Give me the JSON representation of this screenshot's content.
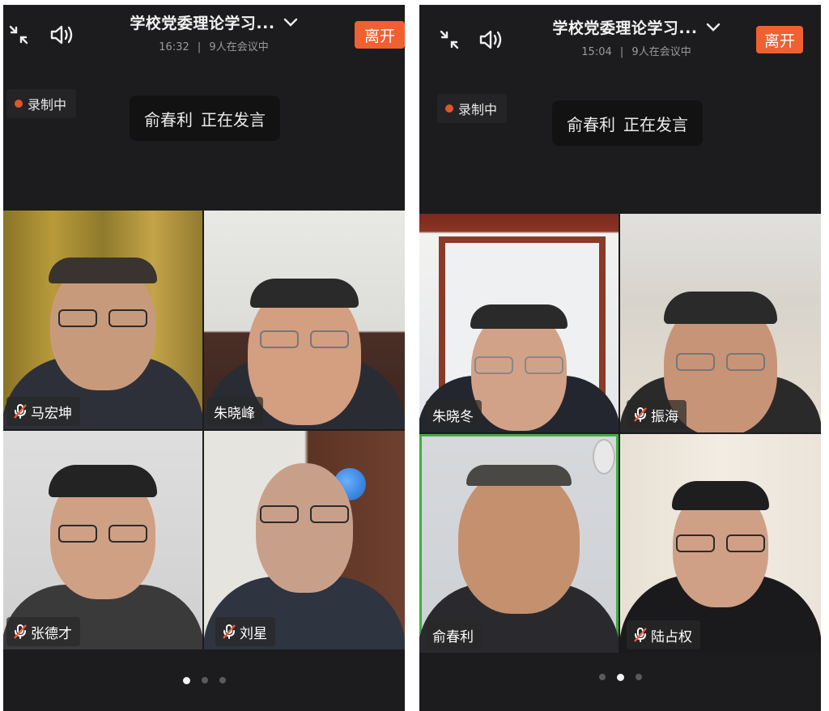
{
  "screens": [
    {
      "title": "学校党委理论学习...",
      "time": "16:32",
      "separator": "|",
      "participants": "9人在会议中",
      "leave_label": "离开",
      "recording_label": "录制中",
      "speaker_name": "俞春利",
      "speaker_status": "正在发言",
      "tiles": [
        {
          "name": "马宏坤",
          "muted": true
        },
        {
          "name": "朱晓峰",
          "muted": false
        },
        {
          "name": "张德才",
          "muted": true
        },
        {
          "name": "刘星",
          "muted": true
        }
      ],
      "page_index": 0,
      "page_count": 3
    },
    {
      "title": "学校党委理论学习...",
      "time": "15:04",
      "separator": "|",
      "participants": "9人在会议中",
      "leave_label": "离开",
      "recording_label": "录制中",
      "speaker_name": "俞春利",
      "speaker_status": "正在发言",
      "tiles": [
        {
          "name": "朱晓冬",
          "muted": false
        },
        {
          "name": "振海",
          "muted": true
        },
        {
          "name": "俞春利",
          "muted": false,
          "active": true
        },
        {
          "name": "陆占权",
          "muted": true
        }
      ],
      "page_index": 1,
      "page_count": 3
    }
  ],
  "icons": {
    "shrink": "shrink-arrows-icon",
    "speaker": "speaker-volume-icon",
    "chevron": "chevron-down-icon",
    "mic_off": "mic-muted-icon"
  },
  "colors": {
    "background": "#1c1c1e",
    "leave_button": "#f06030",
    "recording_dot": "#e0552c",
    "active_speaker_border": "#3fae3f"
  }
}
